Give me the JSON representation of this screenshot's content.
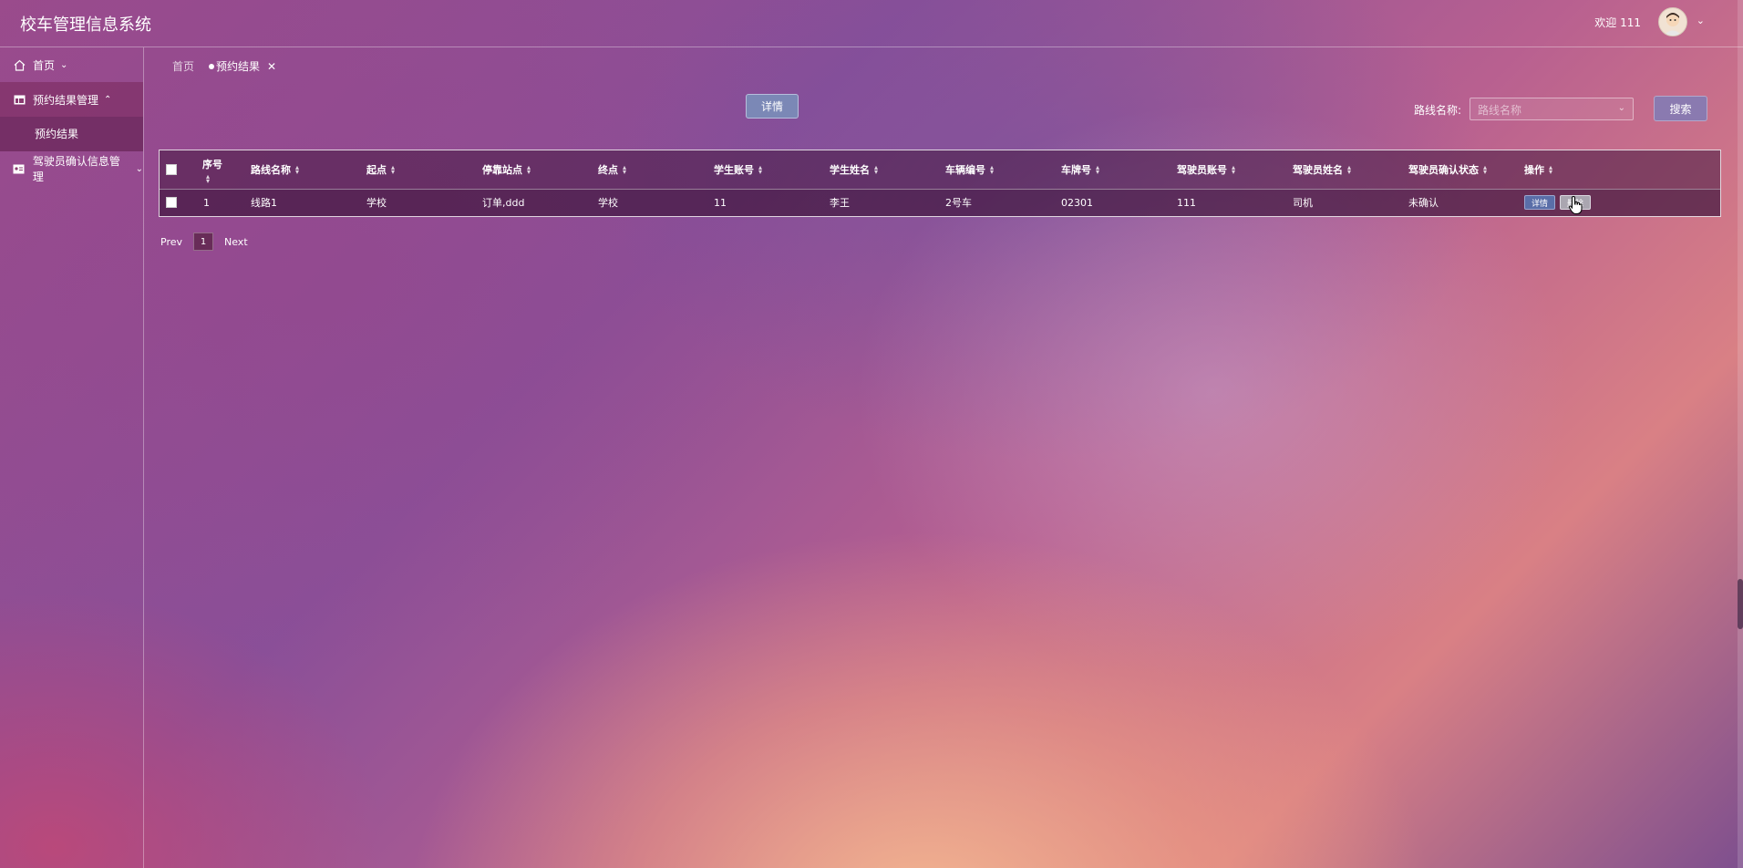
{
  "header": {
    "app_title": "校车管理信息系统",
    "welcome": "欢迎 111"
  },
  "sidebar": {
    "home_label": "首页",
    "group1_label": "预约结果管理",
    "group1_sub": "预约结果",
    "group2_label": "驾驶员确认信息管理"
  },
  "tabs": {
    "home": "首页",
    "current": "预约结果"
  },
  "toolbar": {
    "detail_label": "详情",
    "search_label": "路线名称:",
    "search_placeholder": "路线名称",
    "search_btn": "搜索"
  },
  "table": {
    "columns": [
      "序号",
      "路线名称",
      "起点",
      "停靠站点",
      "终点",
      "学生账号",
      "学生姓名",
      "车辆编号",
      "车牌号",
      "驾驶员账号",
      "驾驶员姓名",
      "驾驶员确认状态",
      "操作"
    ],
    "rows": [
      [
        "1",
        "线路1",
        "学校",
        "订单,ddd",
        "学校",
        "11",
        "李王",
        "2号车",
        "02301",
        "111",
        "司机",
        "未确认"
      ]
    ],
    "op_detail": "详情",
    "op_delete": "删除"
  },
  "pager": {
    "prev": "Prev",
    "page": "1",
    "next": "Next"
  },
  "colors": {
    "accent": "#7b88b6",
    "table_bg": "#46193f"
  },
  "icons": [
    "home-icon",
    "layout-icon",
    "idcard-icon",
    "chevron-down-icon",
    "chevron-up-icon",
    "close-icon",
    "sort-icon",
    "avatar"
  ]
}
